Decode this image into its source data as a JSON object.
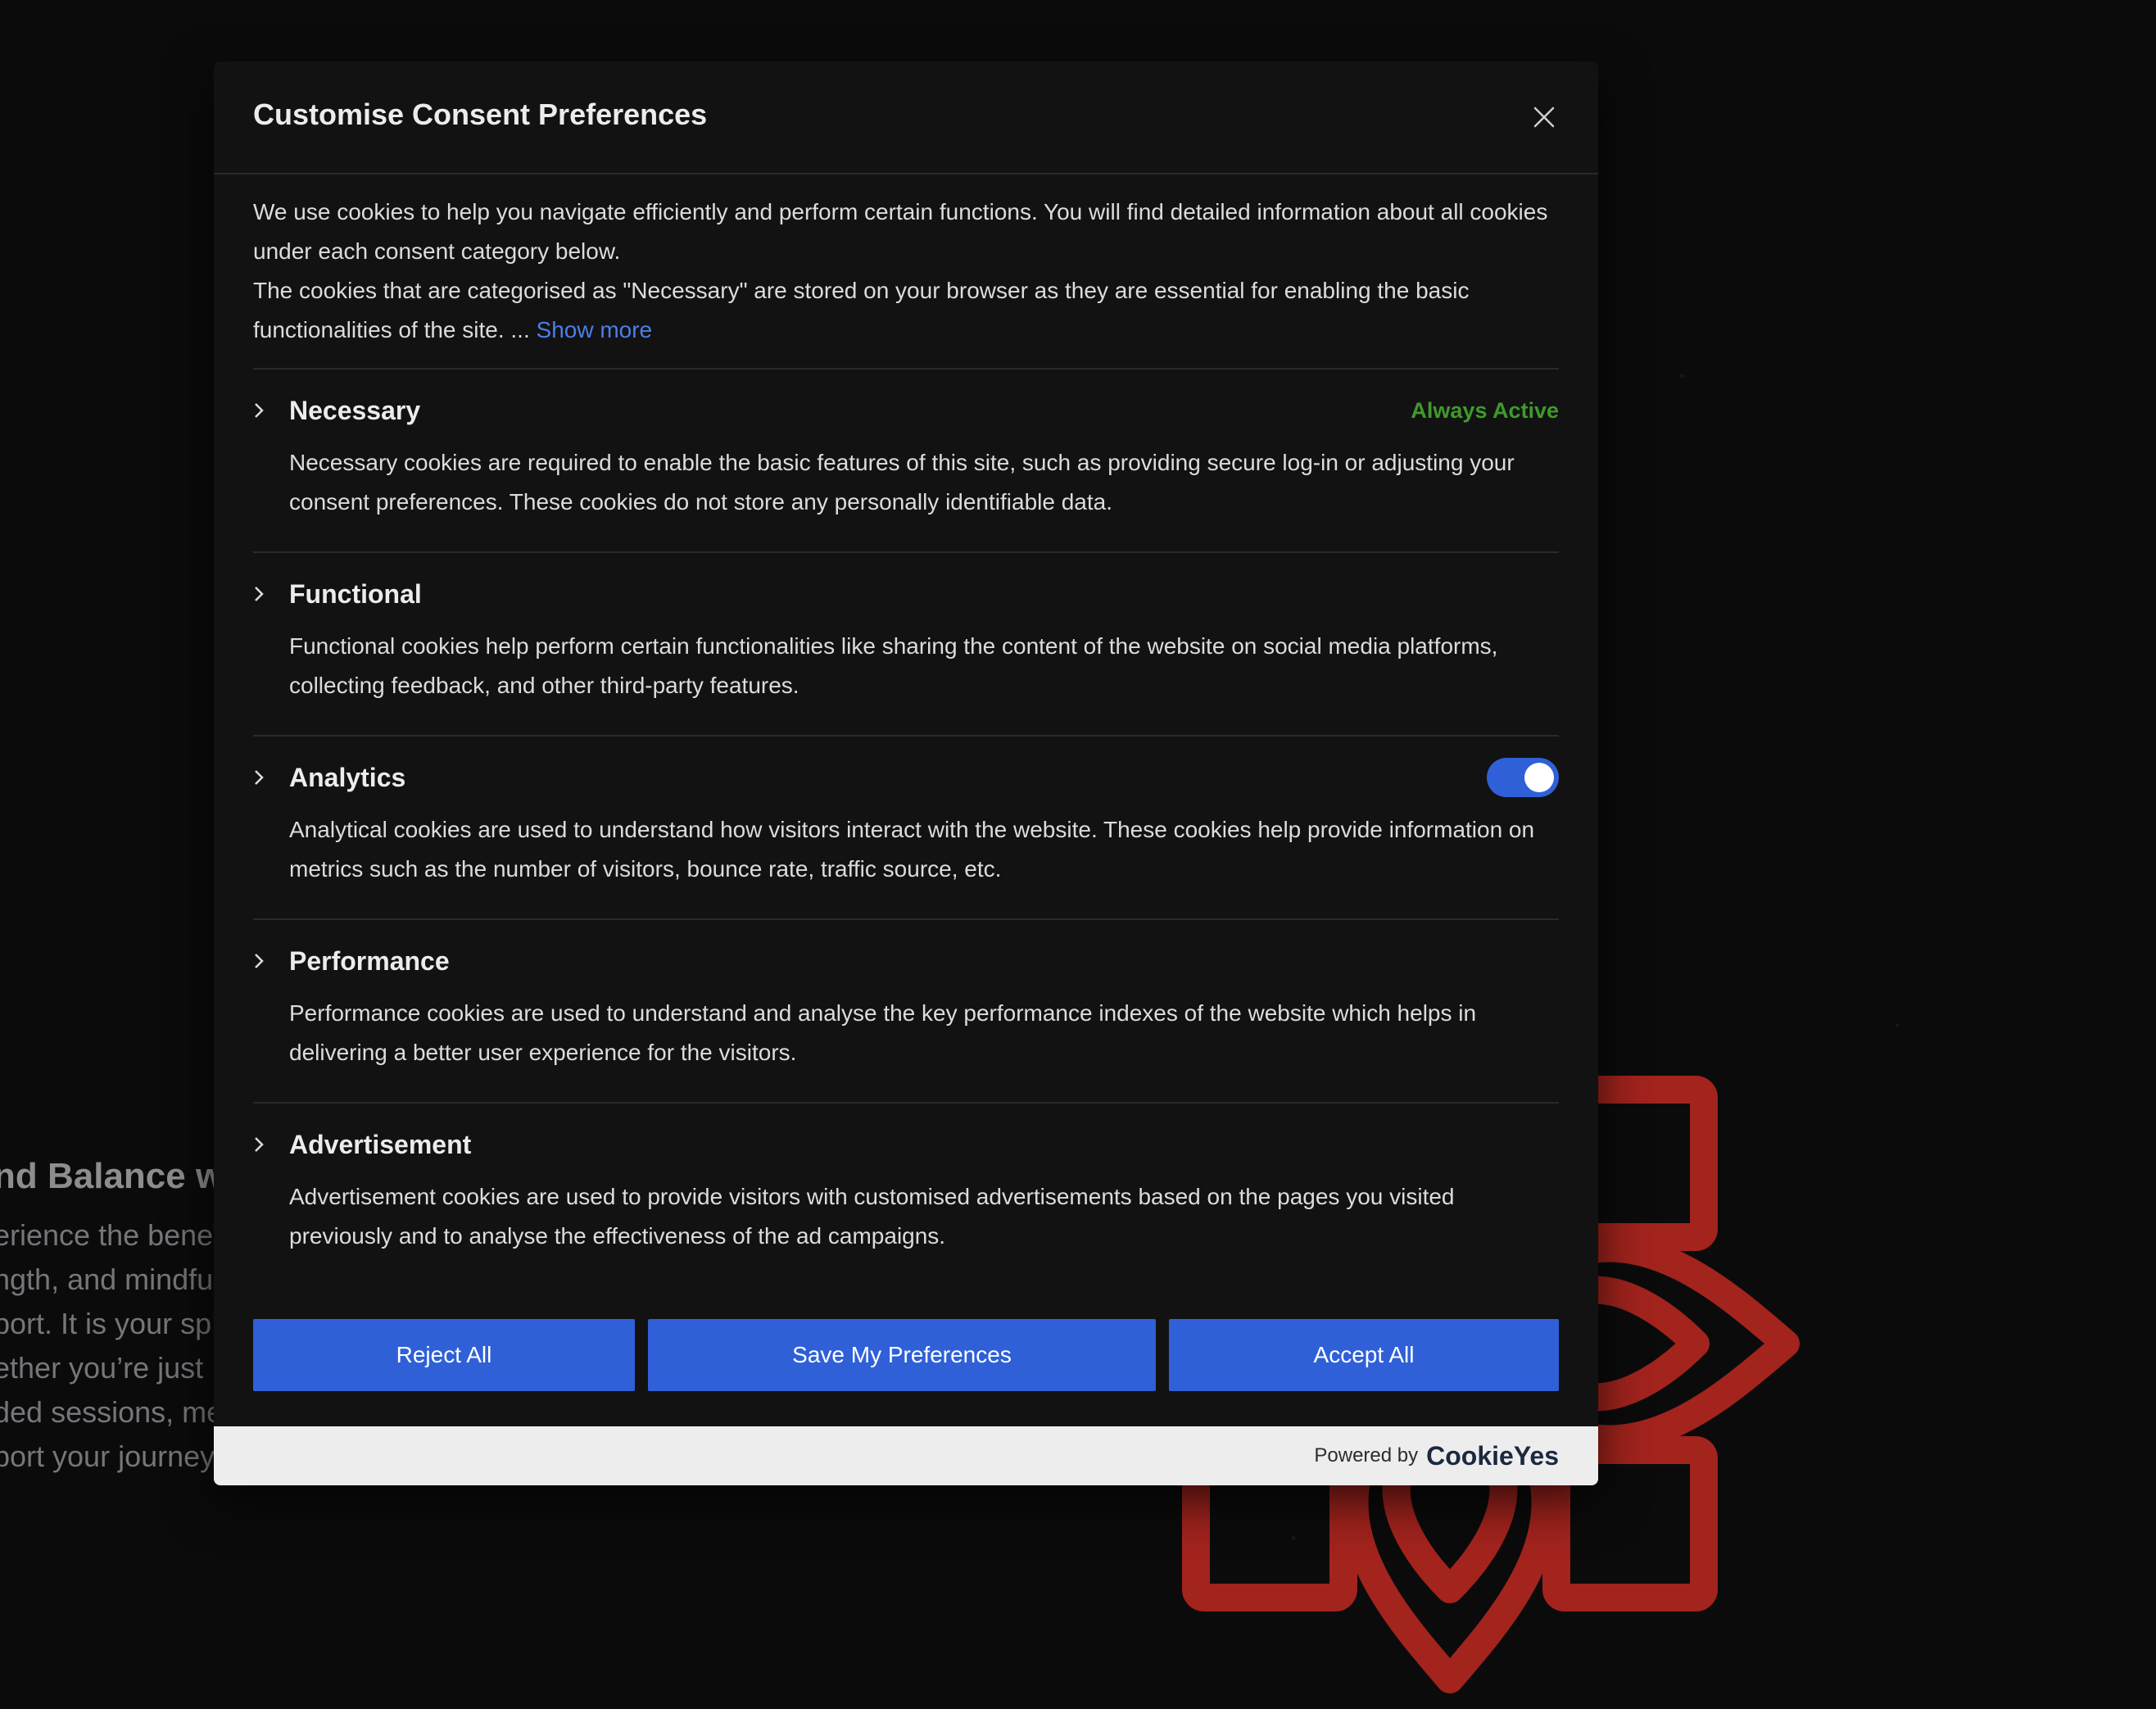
{
  "background": {
    "heading": "nd Balance w",
    "lines": [
      "erience the bene",
      "ngth, and mindfu",
      "port. It is your sp",
      "ether you’re just",
      "ded sessions, me",
      "port your journey"
    ]
  },
  "modal": {
    "title": "Customise Consent Preferences",
    "close_icon": "close-icon",
    "intro_line1": "We use cookies to help you navigate efficiently and perform certain functions. You will find detailed information about all cookies under each consent category below.",
    "intro_line2": "The cookies that are categorised as \"Necessary\" are stored on your browser as they are essential for enabling the basic functionalities of the site. ... ",
    "show_more": "Show more",
    "categories": [
      {
        "title": "Necessary",
        "status": "Always Active",
        "description": "Necessary cookies are required to enable the basic features of this site, such as providing secure log-in or adjusting your consent preferences. These cookies do not store any personally identifiable data."
      },
      {
        "title": "Functional",
        "description": "Functional cookies help perform certain functionalities like sharing the content of the website on social media platforms, collecting feedback, and other third-party features."
      },
      {
        "title": "Analytics",
        "toggle_on": true,
        "description": "Analytical cookies are used to understand how visitors interact with the website. These cookies help provide information on metrics such as the number of visitors, bounce rate, traffic source, etc."
      },
      {
        "title": "Performance",
        "description": "Performance cookies are used to understand and analyse the key performance indexes of the website which helps in delivering a better user experience for the visitors."
      },
      {
        "title": "Advertisement",
        "description": "Advertisement cookies are used to provide visitors with customised advertisements based on the pages you visited previously and to analyse the effectiveness of the ad campaigns."
      }
    ],
    "buttons": {
      "reject": "Reject All",
      "save": "Save My Preferences",
      "accept": "Accept All"
    },
    "footer": {
      "powered_by": "Powered by",
      "brand": "CookieYes"
    }
  },
  "colors": {
    "accent": "#2f60d8",
    "link": "#4d7ee8",
    "always_active": "#3f9a2a",
    "mandala": "#a3231d"
  }
}
